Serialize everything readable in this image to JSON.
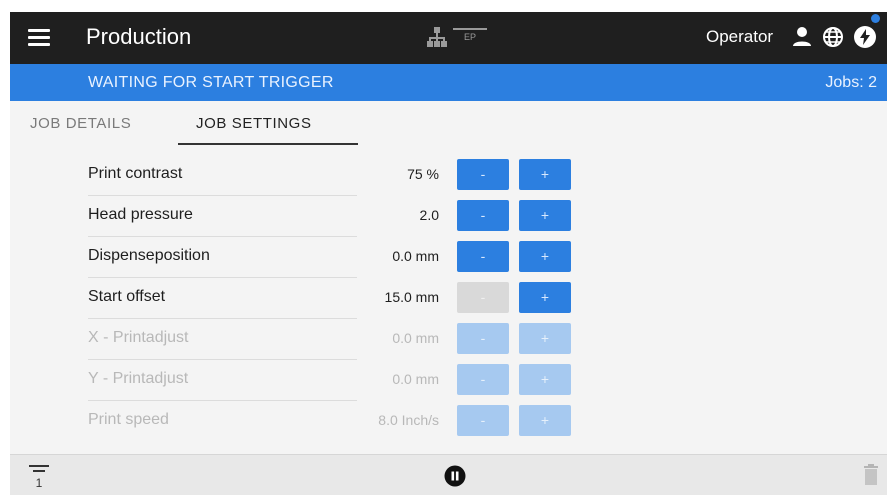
{
  "header": {
    "title": "Production",
    "network_badge": "EP",
    "user_label": "Operator",
    "icons": [
      "menu-icon",
      "network-icon",
      "user-icon",
      "globe-icon",
      "power-icon"
    ]
  },
  "status": {
    "text": "WAITING FOR START TRIGGER",
    "jobs": "Jobs: 2"
  },
  "tabs": [
    {
      "label": "JOB DETAILS",
      "active": false
    },
    {
      "label": "JOB SETTINGS",
      "active": true
    }
  ],
  "settings": {
    "minus_label": "-",
    "plus_label": "+",
    "rows": [
      {
        "label": "Print contrast",
        "value": "75 %",
        "enabled": true,
        "minus_enabled": true,
        "plus_enabled": true
      },
      {
        "label": "Head pressure",
        "value": "2.0",
        "enabled": true,
        "minus_enabled": true,
        "plus_enabled": true
      },
      {
        "label": "Dispenseposition",
        "value": "0.0 mm",
        "enabled": true,
        "minus_enabled": true,
        "plus_enabled": true
      },
      {
        "label": "Start offset",
        "value": "15.0 mm",
        "enabled": true,
        "minus_enabled": false,
        "plus_enabled": true
      },
      {
        "label": "X - Printadjust",
        "value": "0.0 mm",
        "enabled": false,
        "minus_enabled": false,
        "plus_enabled": false
      },
      {
        "label": "Y - Printadjust",
        "value": "0.0 mm",
        "enabled": false,
        "minus_enabled": false,
        "plus_enabled": false
      },
      {
        "label": "Print speed",
        "value": "8.0 Inch/s",
        "enabled": false,
        "minus_enabled": false,
        "plus_enabled": false
      }
    ]
  },
  "footer": {
    "sort_label": "1",
    "icons": [
      "sort-icon",
      "pause-icon",
      "trash-icon"
    ]
  },
  "colors": {
    "topbar": "#1f1f1f",
    "accent": "#2c7fe0",
    "accent_disabled": "#a6c9f0",
    "button_inactive": "#d9d9d9"
  }
}
